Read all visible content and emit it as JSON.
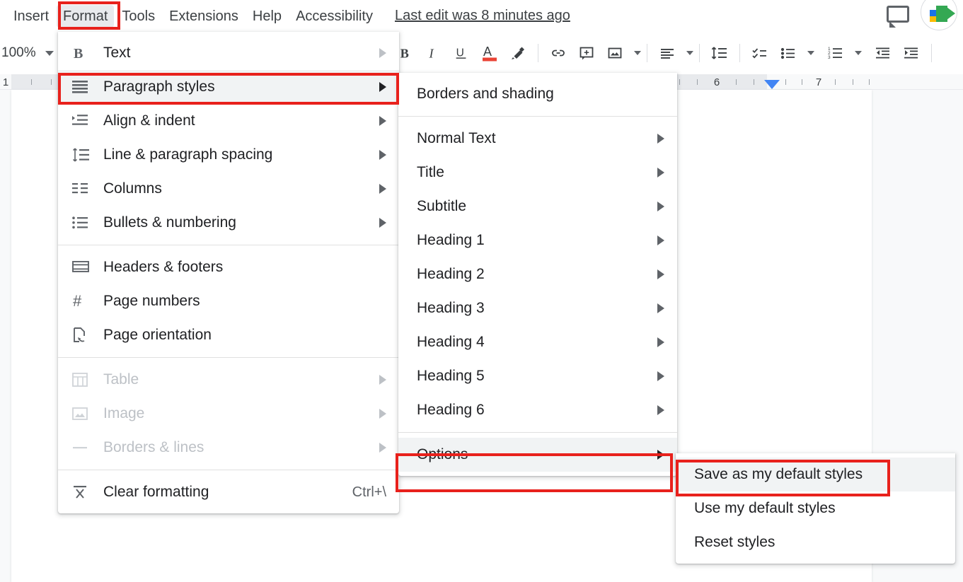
{
  "app": {
    "name": "google-docs"
  },
  "menubar": {
    "items": [
      {
        "label": "Insert",
        "active": false
      },
      {
        "label": "Format",
        "active": true
      },
      {
        "label": "Tools",
        "active": false
      },
      {
        "label": "Extensions",
        "active": false
      },
      {
        "label": "Help",
        "active": false
      },
      {
        "label": "Accessibility",
        "active": false
      }
    ],
    "last_edit": "Last edit was 8 minutes ago",
    "comment_icon": "comment-icon",
    "meet_icon": "google-meet-icon"
  },
  "toolbar": {
    "zoom_value": "100%",
    "buttons": [
      {
        "name": "bold-icon",
        "glyph": "B"
      },
      {
        "name": "italic-icon",
        "glyph": "I"
      },
      {
        "name": "underline-icon",
        "glyph": "U"
      },
      {
        "name": "text-color-icon",
        "glyph": "A",
        "color": "#ea4335"
      },
      {
        "name": "highlight-color-icon",
        "glyph": "pen"
      },
      {
        "name": "insert-link-icon",
        "glyph": "link"
      },
      {
        "name": "add-comment-icon",
        "glyph": "comment-plus"
      },
      {
        "name": "insert-image-icon",
        "glyph": "image"
      },
      {
        "name": "align-icon",
        "glyph": "align-left"
      },
      {
        "name": "line-spacing-icon",
        "glyph": "line-spacing"
      },
      {
        "name": "checklist-icon",
        "glyph": "checklist"
      },
      {
        "name": "bulleted-list-icon",
        "glyph": "bullets"
      },
      {
        "name": "numbered-list-icon",
        "glyph": "numbers"
      },
      {
        "name": "decrease-indent-icon",
        "glyph": "indent-less"
      },
      {
        "name": "increase-indent-icon",
        "glyph": "indent-more"
      }
    ]
  },
  "ruler": {
    "numbers": [
      "1",
      "6",
      "7"
    ],
    "marker": "indent-marker"
  },
  "format_menu": {
    "items": [
      {
        "label": "Text",
        "icon": "bold-text-icon",
        "submenu": true,
        "disabled": false,
        "selected": false,
        "shortcut": ""
      },
      {
        "label": "Paragraph styles",
        "icon": "paragraph-styles-icon",
        "submenu": true,
        "disabled": false,
        "selected": true,
        "shortcut": ""
      },
      {
        "label": "Align & indent",
        "icon": "align-indent-icon",
        "submenu": true,
        "disabled": false,
        "selected": false,
        "shortcut": ""
      },
      {
        "label": "Line & paragraph spacing",
        "icon": "line-spacing-icon",
        "submenu": true,
        "disabled": false,
        "selected": false,
        "shortcut": ""
      },
      {
        "label": "Columns",
        "icon": "columns-icon",
        "submenu": true,
        "disabled": false,
        "selected": false,
        "shortcut": ""
      },
      {
        "label": "Bullets & numbering",
        "icon": "bullets-numbering-icon",
        "submenu": true,
        "disabled": false,
        "selected": false,
        "shortcut": ""
      },
      {
        "divider": true
      },
      {
        "label": "Headers & footers",
        "icon": "headers-footers-icon",
        "submenu": false,
        "disabled": false,
        "selected": false,
        "shortcut": ""
      },
      {
        "label": "Page numbers",
        "icon": "page-numbers-icon",
        "submenu": false,
        "disabled": false,
        "selected": false,
        "shortcut": ""
      },
      {
        "label": "Page orientation",
        "icon": "page-orientation-icon",
        "submenu": false,
        "disabled": false,
        "selected": false,
        "shortcut": ""
      },
      {
        "divider": true
      },
      {
        "label": "Table",
        "icon": "table-icon",
        "submenu": true,
        "disabled": true,
        "selected": false,
        "shortcut": ""
      },
      {
        "label": "Image",
        "icon": "image-icon",
        "submenu": true,
        "disabled": true,
        "selected": false,
        "shortcut": ""
      },
      {
        "label": "Borders & lines",
        "icon": "borders-lines-icon",
        "submenu": true,
        "disabled": true,
        "selected": false,
        "shortcut": ""
      },
      {
        "divider": true
      },
      {
        "label": "Clear formatting",
        "icon": "clear-formatting-icon",
        "submenu": false,
        "disabled": false,
        "selected": false,
        "shortcut": "Ctrl+\\"
      }
    ]
  },
  "paragraph_styles_menu": {
    "items": [
      {
        "label": "Borders and shading",
        "submenu": false,
        "selected": false
      },
      {
        "divider": true
      },
      {
        "label": "Normal Text",
        "submenu": true,
        "selected": false
      },
      {
        "label": "Title",
        "submenu": true,
        "selected": false
      },
      {
        "label": "Subtitle",
        "submenu": true,
        "selected": false
      },
      {
        "label": "Heading 1",
        "submenu": true,
        "selected": false
      },
      {
        "label": "Heading 2",
        "submenu": true,
        "selected": false
      },
      {
        "label": "Heading 3",
        "submenu": true,
        "selected": false
      },
      {
        "label": "Heading 4",
        "submenu": true,
        "selected": false
      },
      {
        "label": "Heading 5",
        "submenu": true,
        "selected": false
      },
      {
        "label": "Heading 6",
        "submenu": true,
        "selected": false
      },
      {
        "divider": true
      },
      {
        "label": "Options",
        "submenu": true,
        "selected": true
      }
    ]
  },
  "options_menu": {
    "items": [
      {
        "label": "Save as my default styles",
        "selected": true
      },
      {
        "label": "Use my default styles",
        "selected": false
      },
      {
        "label": "Reset styles",
        "selected": false
      }
    ]
  },
  "annotations": {
    "highlight_color": "#e8211c",
    "boxes": [
      {
        "name": "format-menu-highlight"
      },
      {
        "name": "paragraph-styles-highlight"
      },
      {
        "name": "options-highlight"
      },
      {
        "name": "save-as-my-default-styles-highlight"
      }
    ]
  }
}
